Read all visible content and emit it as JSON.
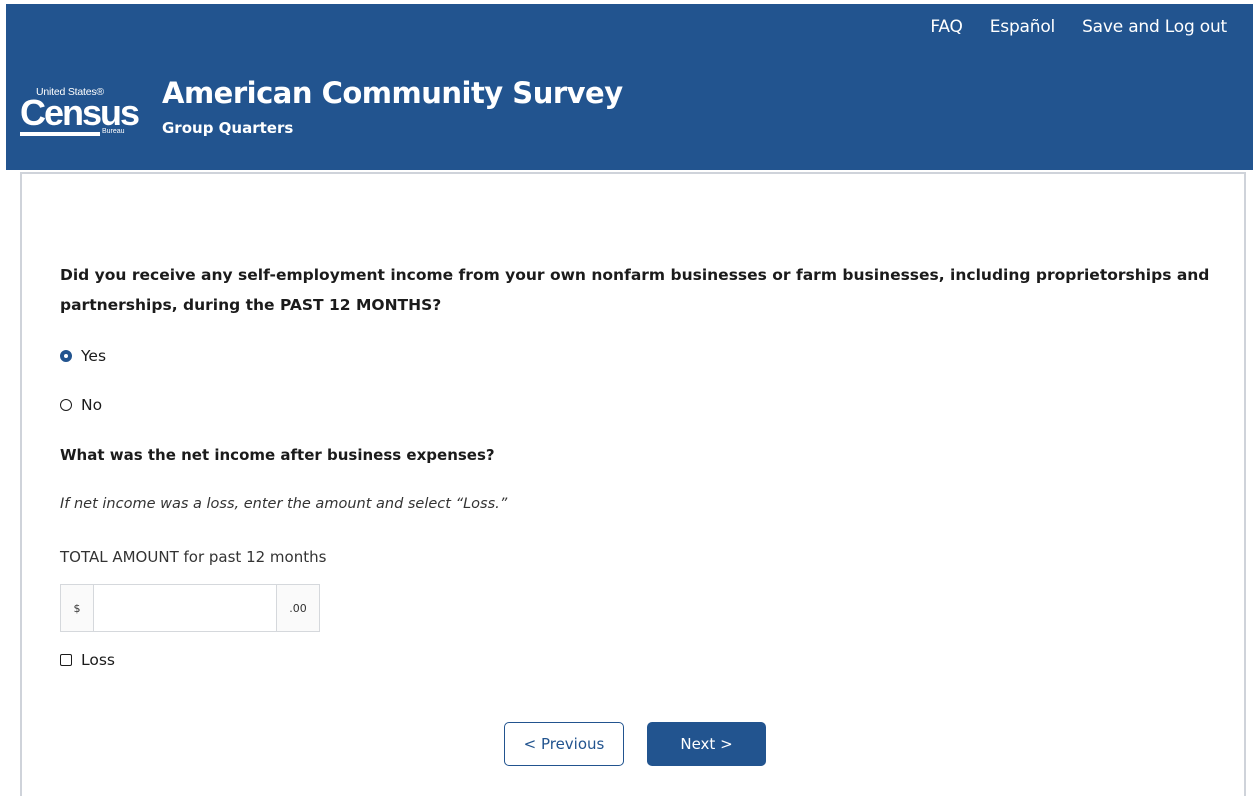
{
  "topnav": {
    "faq": "FAQ",
    "language": "Español",
    "save_logout": "Save and Log out"
  },
  "header": {
    "logo_small": "United States®",
    "logo_big": "Census",
    "logo_bureau": "Bureau",
    "title": "American Community Survey",
    "subtitle": "Group Quarters"
  },
  "question": {
    "text": "Did you receive any self-employment income from your own nonfarm businesses or farm businesses, including proprietorships and partnerships, during the PAST 12 MONTHS?",
    "options": [
      {
        "label": "Yes",
        "selected": true
      },
      {
        "label": "No",
        "selected": false
      }
    ]
  },
  "followup": {
    "question": "What was the net income after business expenses?",
    "hint": "If net income was a loss, enter the amount and select “Loss.”",
    "amount_label": "TOTAL AMOUNT for past 12 months",
    "currency_prefix": "$",
    "cents_suffix": ".00",
    "amount_value": "",
    "loss_label": "Loss",
    "loss_checked": false
  },
  "nav_buttons": {
    "previous": "< Previous",
    "next": "Next >"
  },
  "colors": {
    "brand_blue": "#22548f",
    "panel_border": "#cfd3da"
  }
}
